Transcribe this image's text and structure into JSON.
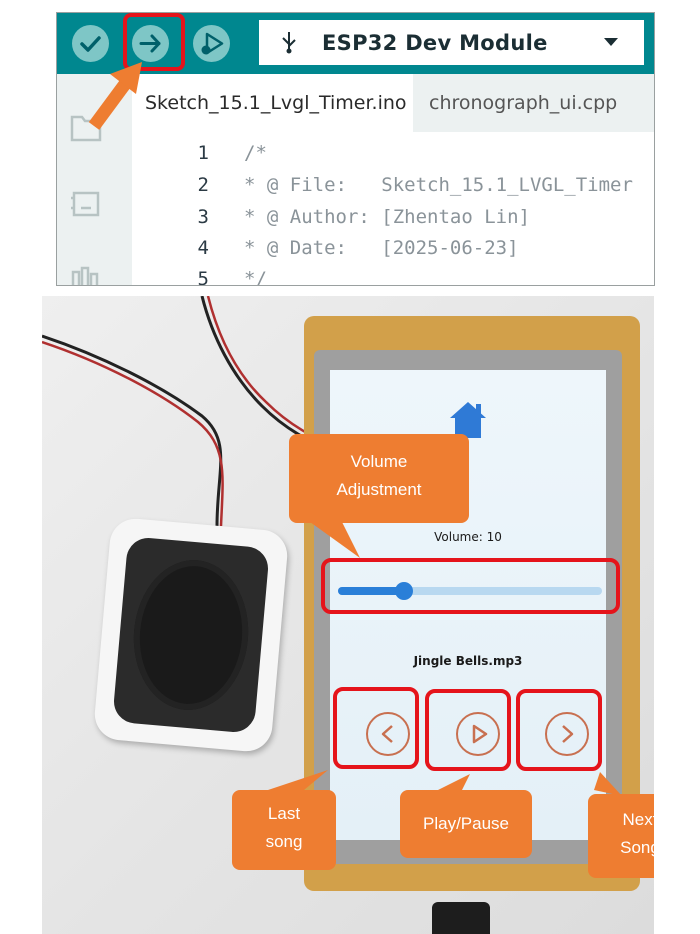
{
  "ide": {
    "toolbar": {
      "verify_icon": "check-icon",
      "upload_icon": "arrow-right-icon",
      "debug_icon": "debug-icon",
      "board_name": "ESP32 Dev Module",
      "usb_icon": "usb-icon"
    },
    "tabs": [
      {
        "label": "Sketch_15.1_Lvgl_Timer.ino"
      },
      {
        "label": "chronograph_ui.cpp"
      }
    ],
    "code_lines": [
      {
        "number": "1",
        "text": "/*"
      },
      {
        "number": "2",
        "text": "* @ File:   Sketch_15.1_LVGL_Timer"
      },
      {
        "number": "3",
        "text": "* @ Author: [Zhentao Lin]"
      },
      {
        "number": "4",
        "text": "* @ Date:   [2025-06-23]"
      },
      {
        "number": "5",
        "text": "*/"
      }
    ],
    "colors": {
      "toolbar": "#00878f",
      "highlight": "#e5141b",
      "accent_arrow": "#ee7d31"
    }
  },
  "device": {
    "volume_label": "Volume: 10",
    "volume_level": 0.25,
    "song_name": "Jingle Bells.mp3",
    "icons": [
      "home-icon",
      "previous-icon",
      "play-icon",
      "next-icon"
    ]
  },
  "callouts": {
    "volume": [
      "Volume",
      "Adjustment"
    ],
    "last": [
      "Last",
      "song"
    ],
    "play": [
      "Play/Pause"
    ],
    "next": [
      "Next",
      "Song"
    ]
  }
}
